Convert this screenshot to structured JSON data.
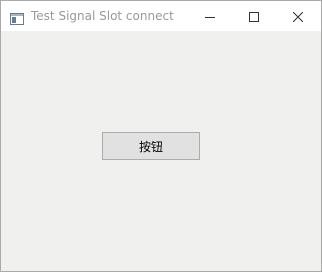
{
  "window": {
    "title": "Test Signal Slot connect",
    "icons": {
      "app": "app-window-icon",
      "minimize": "minimize-icon",
      "maximize": "maximize-icon",
      "close": "close-icon"
    }
  },
  "content": {
    "button_label": "按钮"
  }
}
